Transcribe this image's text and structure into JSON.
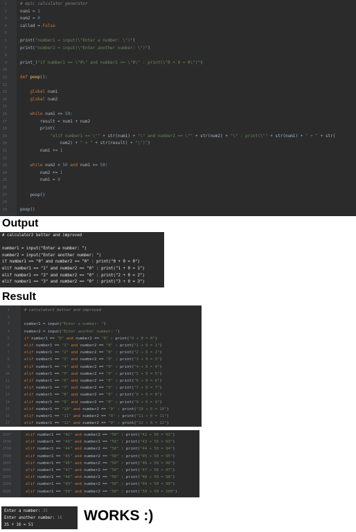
{
  "editor": {
    "lines": [
      {
        "n": "1",
        "t": "# epic calculator generator",
        "c": "cm"
      },
      {
        "n": "2",
        "t": "num1 = 1"
      },
      {
        "n": "3",
        "t": "num2 = 0"
      },
      {
        "n": "4",
        "t": "called = False"
      },
      {
        "n": "5",
        "t": ""
      },
      {
        "n": "6",
        "t": "print(\"number1 = input(\\\"Enter a number: \\\")\")"
      },
      {
        "n": "7",
        "t": "print(\"number2 = input(\\\"Enter another number: \\\")\")"
      },
      {
        "n": "8",
        "t": ""
      },
      {
        "n": "9",
        "t": "print_(\"if number1 == \\\"0\\\" and number2 == \\\"0\\\" : print(\\\"0 + 0 = 0\\\")\")"
      },
      {
        "n": "10",
        "t": ""
      },
      {
        "n": "11",
        "t": "def poop():"
      },
      {
        "n": "12",
        "t": ""
      },
      {
        "n": "13",
        "t": "    global num1"
      },
      {
        "n": "14",
        "t": "    global num2"
      },
      {
        "n": "15",
        "t": ""
      },
      {
        "n": "16",
        "t": "    while num1 <= 50:"
      },
      {
        "n": "17",
        "t": "        result = num1 + num2"
      },
      {
        "n": "18",
        "t": "        print("
      },
      {
        "n": "19",
        "t": "            \"elif number1 == \\\"\" + str(num1) + \"\\\" and number2 == \\\"\" + str(num2) + \"\\\" : print(\\\"\" + str(num1) + \" + \" + str("
      },
      {
        "n": "20",
        "t": "                num2) + \" = \" + str(result) + \"\\\")\")"
      },
      {
        "n": "21",
        "t": "        num1 += 1"
      },
      {
        "n": "22",
        "t": ""
      },
      {
        "n": "23",
        "t": "    while num2 < 50 and num1 >= 50:"
      },
      {
        "n": "24",
        "t": "        num2 += 1"
      },
      {
        "n": "25",
        "t": "        num1 = 0"
      },
      {
        "n": "26",
        "t": ""
      },
      {
        "n": "27",
        "t": "    poop()"
      },
      {
        "n": "28",
        "t": ""
      },
      {
        "n": "29",
        "t": "poop()"
      }
    ]
  },
  "headings": {
    "output": "Output",
    "result": "Result",
    "works": "WORKS :)"
  },
  "output_panel": {
    "lines": [
      "# calculator2 better and improved",
      "",
      "number1 = input(\"Enter a number: \")",
      "number2 = input(\"Enter another number: \")",
      "if number1 == \"0\" and number2 == \"0\" : print(\"0 + 0 = 0\")",
      "elif number1 == \"1\" and number2 == \"0\" : print(\"1 + 0 = 1\")",
      "elif number1 == \"2\" and number2 == \"0\" : print(\"2 + 0 = 2\")",
      "elif number1 == \"3\" and number2 == \"0\" : print(\"3 + 0 = 3\")"
    ]
  },
  "result_panel": {
    "lines": [
      {
        "n": "1",
        "t": "# calculator2 better and improved",
        "c": "cm"
      },
      {
        "n": "2",
        "t": ""
      },
      {
        "n": "3",
        "t": "number1 = input(\"Enter a number: \")"
      },
      {
        "n": "4",
        "t": "number2 = input(\"Enter another number: \")"
      },
      {
        "n": "5",
        "t": "if number1 == \"0\" and number2 == \"0\" : print(\"0 + 0 = 0\")"
      },
      {
        "n": "6",
        "t": "elif number1 == \"1\" and number2 == \"0\" : print(\"1 + 0 = 1\")"
      },
      {
        "n": "7",
        "t": "elif number1 == \"2\" and number2 == \"0\" : print(\"2 + 0 = 2\")"
      },
      {
        "n": "8",
        "t": "elif number1 == \"3\" and number2 == \"0\" : print(\"3 + 0 = 3\")"
      },
      {
        "n": "9",
        "t": "elif number1 == \"4\" and number2 == \"0\" : print(\"4 + 0 = 4\")"
      },
      {
        "n": "10",
        "t": "elif number1 == \"5\" and number2 == \"0\" : print(\"5 + 0 = 5\")"
      },
      {
        "n": "11",
        "t": "elif number1 == \"6\" and number2 == \"0\" : print(\"6 + 0 = 6\")"
      },
      {
        "n": "12",
        "t": "elif number1 == \"7\" and number2 == \"0\" : print(\"7 + 0 = 7\")"
      },
      {
        "n": "13",
        "t": "elif number1 == \"8\" and number2 == \"0\" : print(\"8 + 0 = 8\")"
      },
      {
        "n": "14",
        "t": "elif number1 == \"9\" and number2 == \"0\" : print(\"9 + 0 = 9\")"
      },
      {
        "n": "15",
        "t": "elif number1 == \"10\" and number2 == \"0\" : print(\"10 + 0 = 10\")"
      },
      {
        "n": "16",
        "t": "elif number1 == \"11\" and number2 == \"0\" : print(\"11 + 0 = 11\")"
      },
      {
        "n": "17",
        "t": "elif number1 == \"12\" and number2 == \"0\" : print(\"12 + 0 = 12\")"
      }
    ]
  },
  "result_panel2": {
    "lines": [
      {
        "n": "2597",
        "t": "elif number1 == \"42\" and number2 == \"50\" : print(\"42 + 50 = 92\")"
      },
      {
        "n": "2598",
        "t": "elif number1 == \"43\" and number2 == \"50\" : print(\"43 + 50 = 93\")"
      },
      {
        "n": "2599",
        "t": "elif number1 == \"44\" and number2 == \"50\" : print(\"44 + 50 = 94\")"
      },
      {
        "n": "2600",
        "t": "elif number1 == \"45\" and number2 == \"50\" : print(\"45 + 50 = 95\")"
      },
      {
        "n": "2601",
        "t": "elif number1 == \"46\" and number2 == \"50\" : print(\"46 + 50 = 96\")"
      },
      {
        "n": "2602",
        "t": "elif number1 == \"47\" and number2 == \"50\" : print(\"47 + 50 = 97\")"
      },
      {
        "n": "2603",
        "t": "elif number1 == \"48\" and number2 == \"50\" : print(\"48 + 50 = 98\")"
      },
      {
        "n": "2604",
        "t": "elif number1 == \"49\" and number2 == \"50\" : print(\"49 + 50 = 99\")"
      },
      {
        "n": "2605",
        "t": "elif number1 == \"50\" and number2 == \"50\" : print(\"50 + 50 = 100\")"
      }
    ]
  },
  "console": {
    "lines": [
      {
        "label": "Enter a number: ",
        "value": "35"
      },
      {
        "label": "Enter another number: ",
        "value": "16"
      },
      {
        "label": "35 + 16 = 51",
        "value": ""
      }
    ]
  },
  "colors": {
    "editor_bg": "#2b2b2b",
    "gutter_bg": "#313335",
    "keyword": "#cc7832",
    "string": "#6a8759",
    "number": "#6897bb",
    "comment": "#808080",
    "input_value": "#6a8759"
  }
}
